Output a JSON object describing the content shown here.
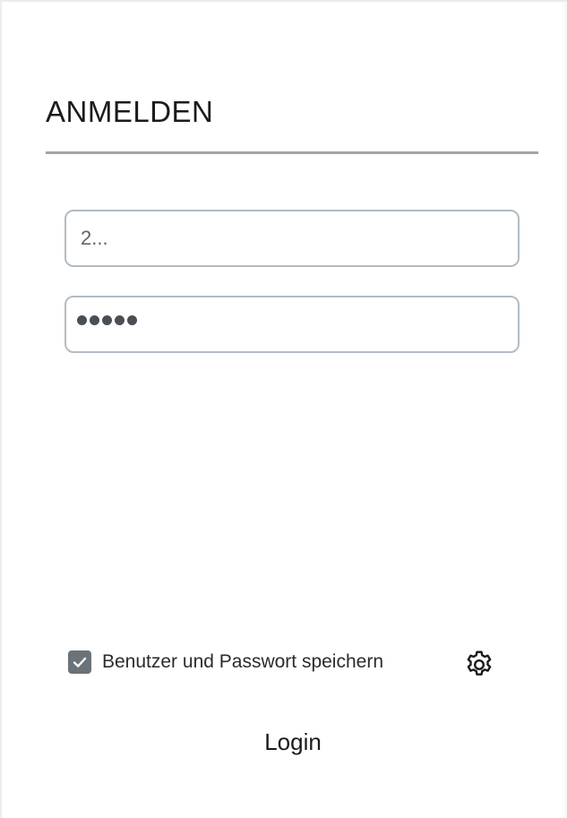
{
  "form": {
    "title": "ANMELDEN",
    "username": {
      "value": "2..."
    },
    "password": {
      "masked": "●●●●●",
      "length": 5
    },
    "remember": {
      "label": "Benutzer und Passwort speichern",
      "checked": true
    },
    "settings_icon": "gear-icon",
    "login_label": "Login"
  },
  "colors": {
    "divider": "#a4a4a4",
    "field_border": "#b3bcc3",
    "checkbox_fill": "#6b7279",
    "text": "#1b1b1b"
  }
}
